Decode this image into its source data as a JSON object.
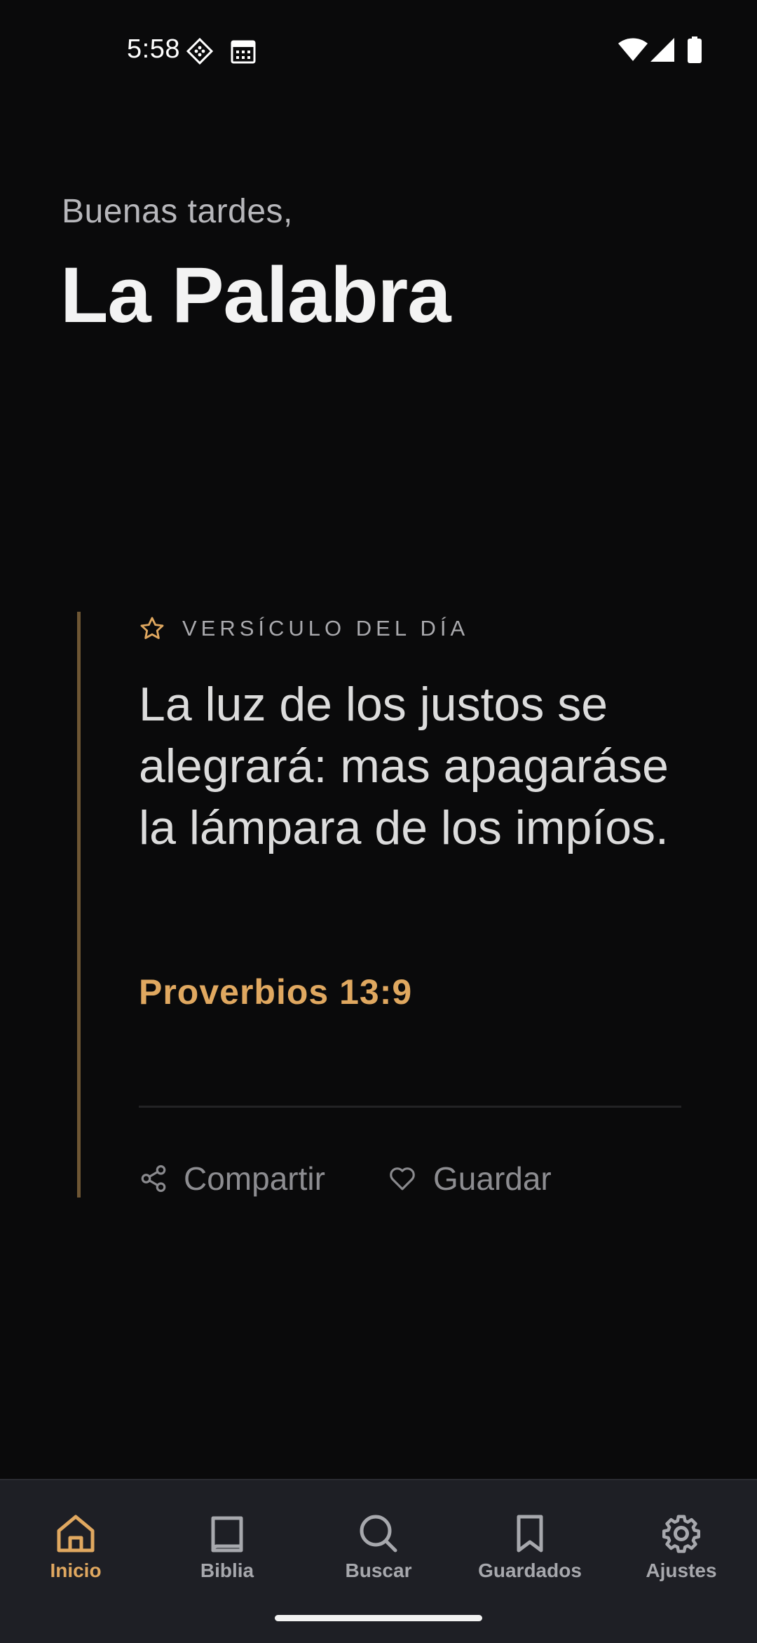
{
  "status_bar": {
    "time": "5:58",
    "icons": [
      "location-diamond-icon",
      "calendar-icon",
      "wifi-icon",
      "cell-signal-icon",
      "battery-icon"
    ]
  },
  "header": {
    "greeting": "Buenas tardes,",
    "title": "La Palabra"
  },
  "verse_card": {
    "kicker": "VERSÍCULO DEL DÍA",
    "kicker_icon": "star-icon",
    "text": "La luz de los justos se alegrará: mas apagaráse la lámpara de los impíos.",
    "reference": "Proverbios 13:9",
    "actions": [
      {
        "label": "Compartir",
        "icon": "share-icon"
      },
      {
        "label": "Guardar",
        "icon": "heart-icon"
      }
    ]
  },
  "bottom_nav": {
    "items": [
      {
        "label": "Inicio",
        "icon": "home-icon",
        "active": true
      },
      {
        "label": "Biblia",
        "icon": "book-icon",
        "active": false
      },
      {
        "label": "Buscar",
        "icon": "search-icon",
        "active": false
      },
      {
        "label": "Guardados",
        "icon": "bookmark-icon",
        "active": false
      },
      {
        "label": "Ajustes",
        "icon": "gear-icon",
        "active": false
      }
    ]
  },
  "colors": {
    "background": "#0a0a0b",
    "accent": "#e0a860",
    "accent_bar": "#6e5634",
    "nav_background": "#1e1f25",
    "nav_inactive": "#a7a8ad"
  }
}
